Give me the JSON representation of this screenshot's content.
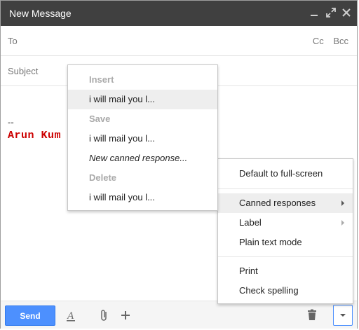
{
  "window": {
    "title": "New Message"
  },
  "titlebar_icons": [
    "minimize-icon",
    "expand-icon",
    "close-icon"
  ],
  "fields": {
    "to_label": "To",
    "cc_label": "Cc",
    "bcc_label": "Bcc",
    "subject_label": "Subject"
  },
  "body": {
    "sig_dash": "--",
    "sig_name": "Arun Kum"
  },
  "toolbar": {
    "send_label": "Send"
  },
  "canned_menu": {
    "insert_header": "Insert",
    "insert_item": "i will mail you l...",
    "save_header": "Save",
    "save_item": "i will mail you l...",
    "new_canned": "New canned response...",
    "delete_header": "Delete",
    "delete_item": "i will mail you l..."
  },
  "more_menu": {
    "fullscreen": "Default to full-screen",
    "canned": "Canned responses",
    "label": "Label",
    "plain_text": "Plain text mode",
    "print": "Print",
    "check_spelling": "Check spelling"
  },
  "colors": {
    "titlebar": "#404040",
    "send": "#4d90fe",
    "signature": "#cc0000"
  }
}
